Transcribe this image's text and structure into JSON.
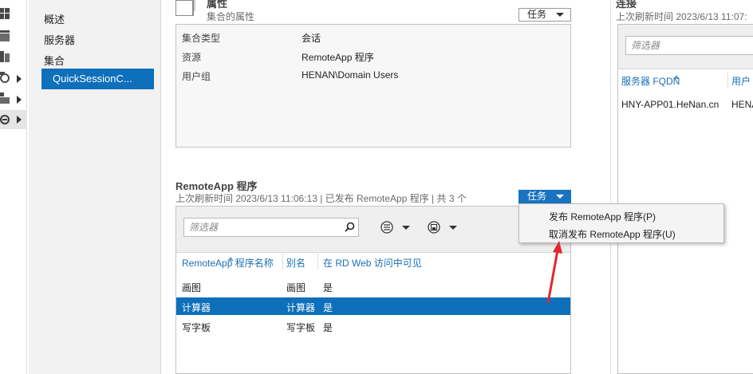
{
  "nav": {
    "items": [
      "概述",
      "服务器",
      "集合"
    ],
    "selected": "QuickSessionC..."
  },
  "properties": {
    "title": "属性",
    "subtitle": "集合的属性",
    "task_label": "任务",
    "rows": [
      {
        "key": "集合类型",
        "value": "会话"
      },
      {
        "key": "资源",
        "value": "RemoteApp 程序"
      },
      {
        "key": "用户组",
        "value": "HENAN\\Domain Users"
      }
    ]
  },
  "remoteapp": {
    "title": "RemoteApp 程序",
    "subtitle": "上次刷新时间 2023/6/13 11:06:13 | 已发布 RemoteApp 程序 | 共 3 个",
    "task_label": "任务",
    "filter_placeholder": "筛选器",
    "columns": [
      "RemoteApp 程序名称",
      "别名",
      "在 RD Web 访问中可见"
    ],
    "rows": [
      {
        "name": "画图",
        "alias": "画图",
        "visible": "是"
      },
      {
        "name": "计算器",
        "alias": "计算器",
        "visible": "是"
      },
      {
        "name": "写字板",
        "alias": "写字板",
        "visible": "是"
      }
    ],
    "selected_row": 1
  },
  "task_menu": {
    "items": [
      "发布 RemoteApp 程序(P)",
      "取消发布 RemoteApp 程序(U)"
    ]
  },
  "connections": {
    "title": "连接",
    "subtitle": "上次刷新时间 2023/6/13 11:07:",
    "filter_placeholder": "筛选器",
    "columns": [
      "服务器 FQDN",
      "用户"
    ],
    "rows": [
      {
        "server": "HNY-APP01.HeNan.cn",
        "user": "HENA"
      }
    ]
  },
  "colors": {
    "accent": "#0e6fba",
    "annotation_arrow": "#e0262e"
  }
}
